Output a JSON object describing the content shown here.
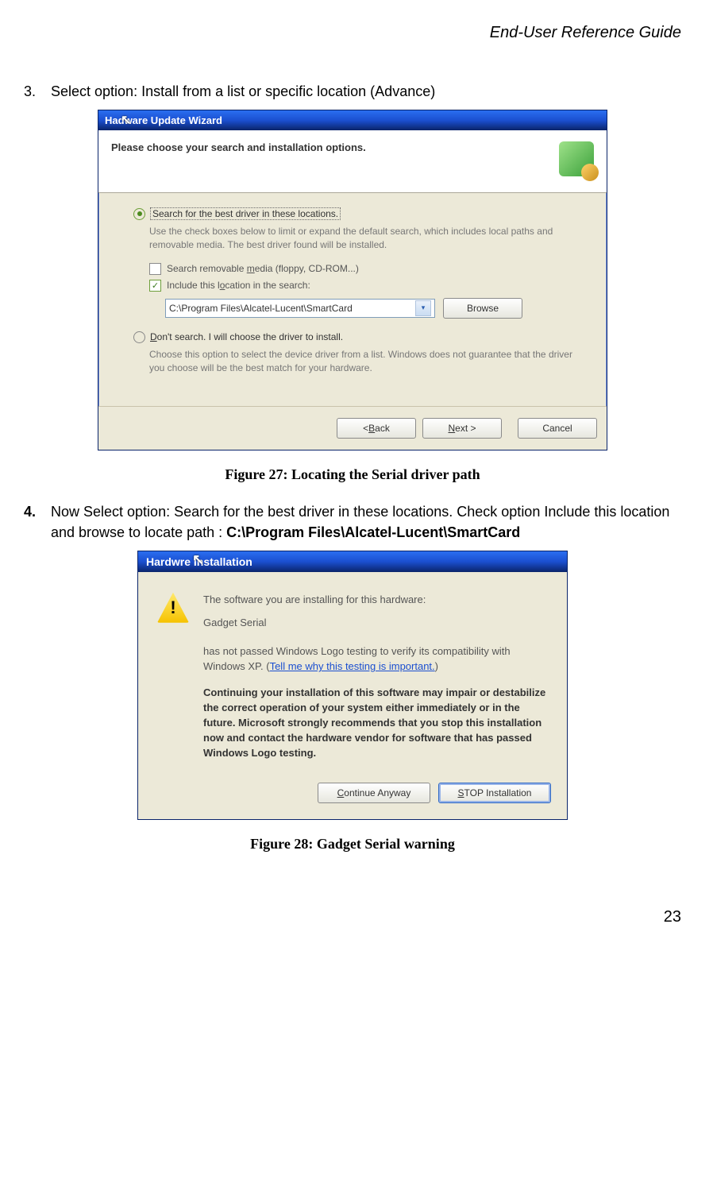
{
  "header": "End-User Reference Guide",
  "page_number": "23",
  "step3": {
    "num": "3.",
    "text": "Select option: Install from a list or specific location (Advance)"
  },
  "caption1": "Figure 27: Locating the Serial driver path",
  "step4": {
    "num": "4.",
    "pre": "Now Select option: Search for the best driver in these locations. Check option Include this location and browse to locate path : ",
    "bold": "C:\\Program Files\\Alcatel-Lucent\\SmartCard"
  },
  "caption2": "Figure 28: Gadget Serial warning",
  "dlg1": {
    "title_pre": "Ha",
    "title_post": "dware Update Wizard",
    "subheader": "Please choose your search and installation options.",
    "opt1_pre": "Search for the best driver in these locations.",
    "opt1_hint": "Use the check boxes below to limit or expand the default search, which includes local paths and removable media. The best driver found will be installed.",
    "cb1_pre": "Search removable ",
    "cb1_u": "m",
    "cb1_post": "edia (floppy, CD-ROM...)",
    "cb2_pre": "Include this l",
    "cb2_u": "o",
    "cb2_post": "cation in the search:",
    "path": "C:\\Program Files\\Alcatel-Lucent\\SmartCard",
    "browse": "Browse",
    "opt2_u": "D",
    "opt2_post": "on't search. I will choose the driver to install.",
    "opt2_hint": "Choose this option to select the device driver from a list.  Windows does not guarantee that the driver you choose will be the best match for your hardware.",
    "back_pre": "< ",
    "back_u": "B",
    "back_post": "ack",
    "next_u": "N",
    "next_post": "ext >",
    "cancel": "Cancel"
  },
  "dlg2": {
    "title_pre": "Hardw",
    "title_post": "re Installation",
    "line1": "The software you are installing for this hardware:",
    "device": "Gadget Serial",
    "line2a": "has not passed Windows Logo testing to verify its compatibility with Windows XP. (",
    "link": "Tell me why this testing is important.",
    "line2b": ")",
    "bold": "Continuing your installation of this software may impair or destabilize the correct operation of your system either immediately or in the future. Microsoft strongly recommends that you stop this installation now and contact the hardware vendor for software that has passed Windows Logo testing.",
    "btn_continue_u": "C",
    "btn_continue_post": "ontinue Anyway",
    "btn_stop_u": "S",
    "btn_stop_post": "TOP Installation"
  }
}
